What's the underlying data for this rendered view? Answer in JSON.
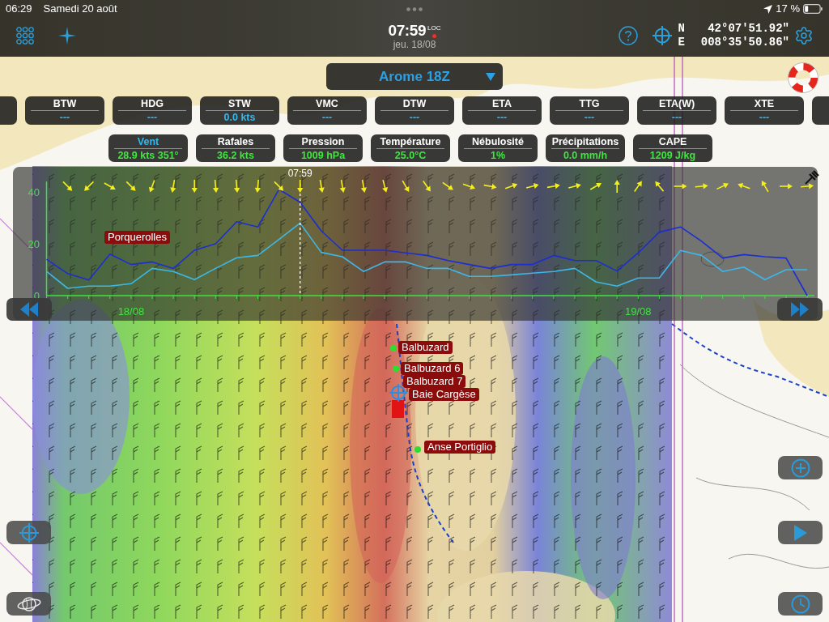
{
  "status_bar": {
    "time": "06:29",
    "date": "Samedi 20 août",
    "battery": "17 %"
  },
  "toolbar": {
    "clock": {
      "time": "07:59",
      "zone": "LOC",
      "indicator": true,
      "date": "jeu. 18/08"
    },
    "coordinates": [
      {
        "hemisphere": "N",
        "value": "42°07'51.92\""
      },
      {
        "hemisphere": "E",
        "value": "008°35'50.86\""
      }
    ]
  },
  "model_selector": {
    "label": "Arome 18Z"
  },
  "instruments": [
    {
      "label": "BTW",
      "value": "---"
    },
    {
      "label": "HDG",
      "value": "---"
    },
    {
      "label": "STW",
      "value": "0.0 kts"
    },
    {
      "label": "VMC",
      "value": "---"
    },
    {
      "label": "DTW",
      "value": "---"
    },
    {
      "label": "ETA",
      "value": "---"
    },
    {
      "label": "TTG",
      "value": "---"
    },
    {
      "label": "ETA(W)",
      "value": "---"
    },
    {
      "label": "XTE",
      "value": "---"
    }
  ],
  "weather": [
    {
      "label": "Vent",
      "value": "28.9 kts 351°",
      "selected": true
    },
    {
      "label": "Rafales",
      "value": "36.2 kts",
      "selected": false
    },
    {
      "label": "Pression",
      "value": "1009 hPa",
      "selected": false
    },
    {
      "label": "Température",
      "value": "25.0°C",
      "selected": false
    },
    {
      "label": "Nébulosité",
      "value": "1%",
      "selected": false
    },
    {
      "label": "Précipitations",
      "value": "0.0 mm/h",
      "selected": false
    },
    {
      "label": "CAPE",
      "value": "1209 J/kg",
      "selected": false
    }
  ],
  "chart": {
    "chart_data": {
      "type": "line",
      "categories": [
        null,
        null,
        null,
        null,
        "18/08",
        null,
        null,
        null,
        null,
        null,
        null,
        null,
        null,
        null,
        null,
        null,
        null,
        null,
        null,
        null,
        null,
        null,
        null,
        null,
        null,
        null,
        null,
        null,
        "19/08",
        null,
        null,
        null,
        null,
        null,
        null,
        null,
        null
      ],
      "ylim": [
        0,
        44
      ],
      "yticks": [
        0,
        20,
        40
      ],
      "series": [
        {
          "color": "#1c2ed2",
          "values": [
            14,
            8.5,
            6,
            16,
            12,
            13,
            10.5,
            17.5,
            20,
            28.5,
            26.5,
            41,
            36,
            25,
            17.5,
            17.5,
            17.5,
            16.5,
            15.5,
            13.5,
            12,
            10.5,
            12,
            12,
            15.5,
            13.5,
            13.5,
            9.5,
            16.5,
            24.5,
            26.5,
            21,
            14.5,
            15.8,
            15,
            14.5,
            0
          ]
        },
        {
          "color": "#3db8e8",
          "values": [
            9.3,
            2.8,
            3.7,
            3.7,
            4.6,
            10.5,
            9.3,
            6.2,
            10.5,
            14.6,
            15.5,
            21.7,
            28,
            16.7,
            15,
            9.3,
            13,
            13,
            10.5,
            10.5,
            7.4,
            7.4,
            8,
            8.7,
            9.3,
            10.5,
            5.3,
            3.7,
            6.8,
            6.8,
            17.4,
            15.5,
            9.3,
            11,
            6.2,
            10,
            10
          ]
        }
      ],
      "annotations": [
        "07:59"
      ]
    }
  },
  "map": {
    "waypoints": [
      {
        "label": "Porquerolles"
      },
      {
        "label": "Balbuzard"
      },
      {
        "label": "Balbuzard 6"
      },
      {
        "label": "Balbuzard 7"
      },
      {
        "label": "Baie Cargèse"
      },
      {
        "label": "Anse Portiglio"
      }
    ]
  }
}
